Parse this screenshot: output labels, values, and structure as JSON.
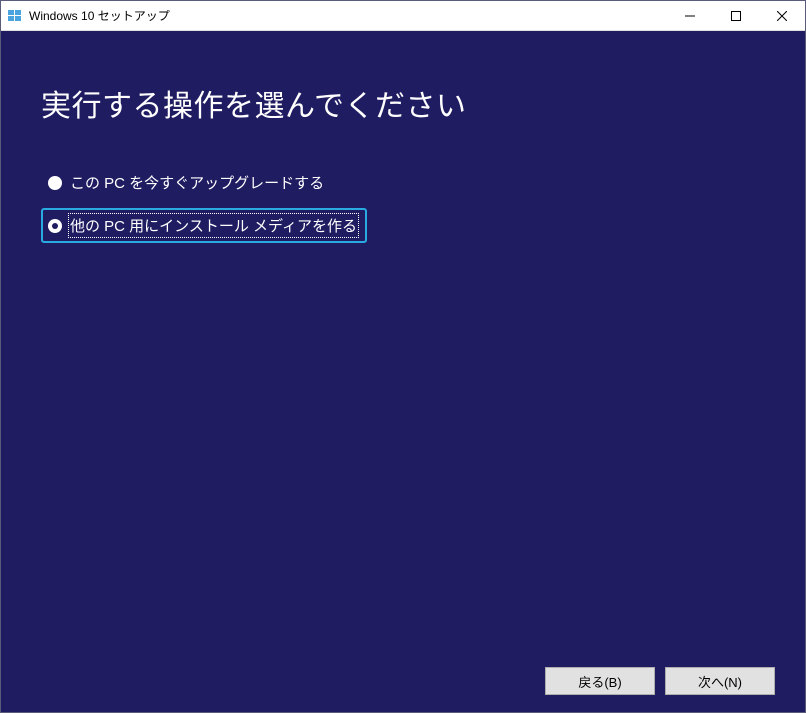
{
  "window": {
    "title": "Windows 10 セットアップ"
  },
  "content": {
    "heading": "実行する操作を選んでください",
    "options": [
      {
        "label": "この PC を今すぐアップグレードする",
        "selected": false
      },
      {
        "label": "他の PC 用にインストール メディアを作る",
        "selected": true
      }
    ]
  },
  "footer": {
    "back": "戻る(B)",
    "next": "次へ(N)"
  }
}
